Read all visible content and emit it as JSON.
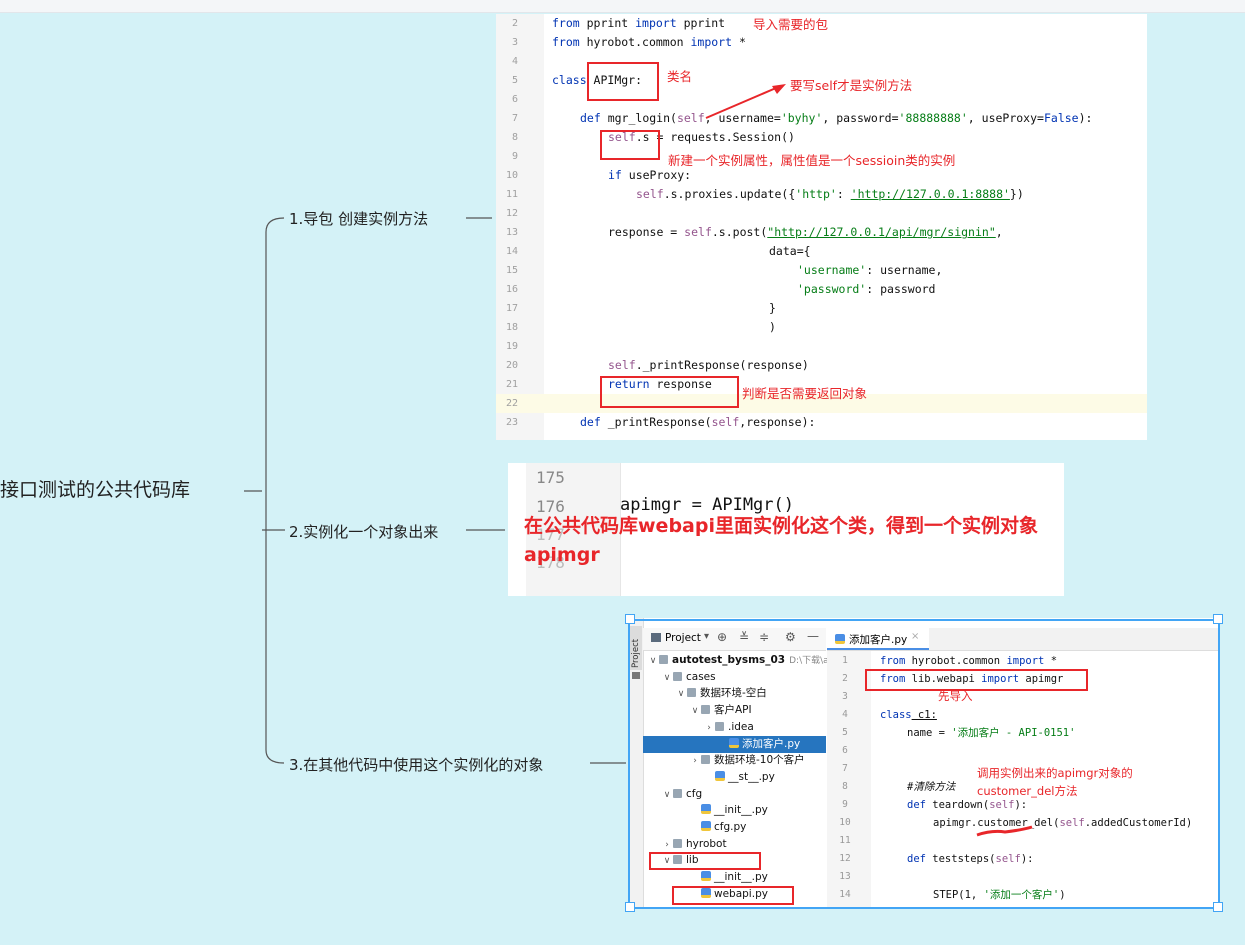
{
  "mindmap": {
    "root": "接口测试的公共代码库",
    "branches": [
      "1.导包 创建实例方法",
      "2.实例化一个对象出来",
      "3.在其他代码中使用这个实例化的对象"
    ]
  },
  "panel1": {
    "line_numbers": [
      "2",
      "3",
      "4",
      "5",
      "6",
      "7",
      "8",
      "9",
      "10",
      "11",
      "12",
      "13",
      "14",
      "15",
      "16",
      "17",
      "18",
      "19",
      "20",
      "21",
      "22",
      "23"
    ],
    "code": {
      "l2a": "from",
      "l2b": " pprint ",
      "l2c": "import",
      "l2d": " pprint",
      "l3a": "from",
      "l3b": " hyrobot.common ",
      "l3c": "import",
      "l3d": " *",
      "l5a": "class",
      "l5b": " APIMgr:",
      "l7a": "def",
      "l7b": " mgr_login(",
      "l7c": "self",
      "l7d": ", username=",
      "l7e": "'byhy'",
      "l7f": ", password=",
      "l7g": "'88888888'",
      "l7h": ", useProxy=",
      "l7i": "False",
      "l7j": "):",
      "l8a": "self",
      "l8b": ".s = requests.Session()",
      "l10a": "if",
      "l10b": " useProxy:",
      "l11a": "self",
      "l11b": ".s.proxies.update({",
      "l11c": "'http'",
      "l11d": ": ",
      "l11e": "'http://127.0.0.1:8888'",
      "l11f": "})",
      "l13a": "response = ",
      "l13b": "self",
      "l13c": ".s.post(",
      "l13d": "\"http://127.0.0.1/api/mgr/signin\"",
      "l13e": ",",
      "l14": "data={",
      "l15a": "'username'",
      "l15b": ": username,",
      "l16a": "'password'",
      "l16b": ": password",
      "l17": "}",
      "l18": ")",
      "l20a": "self",
      "l20b": "._printResponse(response)",
      "l21a": "return",
      "l21b": " response",
      "l23a": "def",
      "l23b": " _printResponse(",
      "l23c": "self",
      "l23d": ",response):"
    },
    "annotations": {
      "import_note": "导入需要的包",
      "class_note": "类名",
      "self_note": "要写self才是实例方法",
      "attr_note": "新建一个实例属性，属性值是一个sessioin类的实例",
      "return_note": "判断是否需要返回对象"
    }
  },
  "panel2": {
    "line_numbers": [
      "175",
      "176",
      "177",
      "178"
    ],
    "code": "apimgr = APIMgr()",
    "note": "在公共代码库webapi里面实例化这个类，得到一个实例对象apimgr"
  },
  "panel3": {
    "toolbar_label": "Project",
    "side_tab": "Project",
    "editor_tab": "添加客户.py",
    "tree": [
      {
        "label": "autotest_bysms_03",
        "suffix": "D:\\下载\\au",
        "indent": 0,
        "type": "folder",
        "chev": "v",
        "bold": true
      },
      {
        "label": "cases",
        "indent": 1,
        "type": "folder",
        "chev": "v"
      },
      {
        "label": "数据环境-空白",
        "indent": 2,
        "type": "folder",
        "chev": "v"
      },
      {
        "label": "客户API",
        "indent": 3,
        "type": "folder",
        "chev": "v"
      },
      {
        "label": ".idea",
        "indent": 4,
        "type": "folder",
        "chev": ">"
      },
      {
        "label": "添加客户.py",
        "indent": 5,
        "type": "py",
        "chev": "",
        "active": true
      },
      {
        "label": "数据环境-10个客户",
        "indent": 3,
        "type": "folder",
        "chev": ">"
      },
      {
        "label": "__st__.py",
        "indent": 4,
        "type": "py",
        "chev": ""
      },
      {
        "label": "cfg",
        "indent": 1,
        "type": "folder",
        "chev": "v"
      },
      {
        "label": "__init__.py",
        "indent": 3,
        "type": "py",
        "chev": ""
      },
      {
        "label": "cfg.py",
        "indent": 3,
        "type": "py",
        "chev": ""
      },
      {
        "label": "hyrobot",
        "indent": 1,
        "type": "folder",
        "chev": ">"
      },
      {
        "label": "lib",
        "indent": 1,
        "type": "folder",
        "chev": "v"
      },
      {
        "label": "__init__.py",
        "indent": 3,
        "type": "py",
        "chev": ""
      },
      {
        "label": "webapi.py",
        "indent": 3,
        "type": "py",
        "chev": ""
      }
    ],
    "line_numbers": [
      "1",
      "2",
      "3",
      "4",
      "5",
      "6",
      "7",
      "8",
      "9",
      "10",
      "11",
      "12",
      "13",
      "14"
    ],
    "code": {
      "e1a": "from",
      "e1b": " hyrobot.common ",
      "e1c": "import",
      "e1d": " *",
      "e2a": "from",
      "e2b": " lib.webapi ",
      "e2c": "import",
      "e2d": " apimgr",
      "e4a": "class",
      "e4b": " c1:",
      "e5a": "name = ",
      "e5b": "'添加客户 - API-0151'",
      "e8": "#清除方法",
      "e9a": "def",
      "e9b": " teardown(",
      "e9c": "self",
      "e9d": "):",
      "e10a": "apimgr.customer_del(",
      "e10b": "self",
      "e10c": ".addedCustomerId)",
      "e12a": "def",
      "e12b": " teststeps(",
      "e12c": "self",
      "e12d": "):",
      "e14a": "STEP(1, ",
      "e14b": "'添加一个客户'",
      "e14c": ")"
    },
    "annotations": {
      "import_first": "先导入",
      "call_note_1": "调用实例出来的apimgr对象的",
      "call_note_2": "customer_del方法"
    }
  },
  "colors": {
    "background": "#d4f2f7",
    "annotation_red": "#e8262a",
    "selection_blue": "#42a5f5",
    "keyword": "#0033b3",
    "self_purple": "#94558d",
    "string_green": "#067d17"
  }
}
